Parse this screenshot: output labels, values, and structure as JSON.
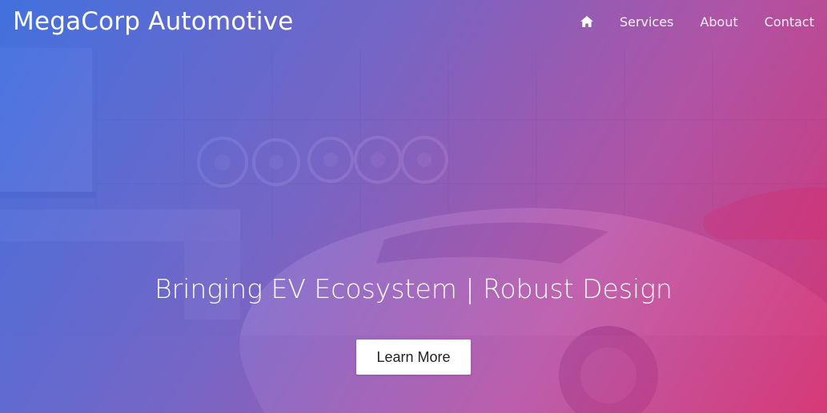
{
  "navbar": {
    "brand": "MegaCorp Automotive",
    "home_icon": "home-icon",
    "links": [
      {
        "label": "Services"
      },
      {
        "label": "About"
      },
      {
        "label": "Contact"
      }
    ]
  },
  "hero": {
    "headline": "Bringing EV Ecosystem | Robust Design",
    "cta_label": "Learn More",
    "background": "car showroom photo with gradient overlay",
    "gradient_colors": [
      "#3c6ee1",
      "#705cc8",
      "#b946a0",
      "#d72d6e"
    ]
  }
}
